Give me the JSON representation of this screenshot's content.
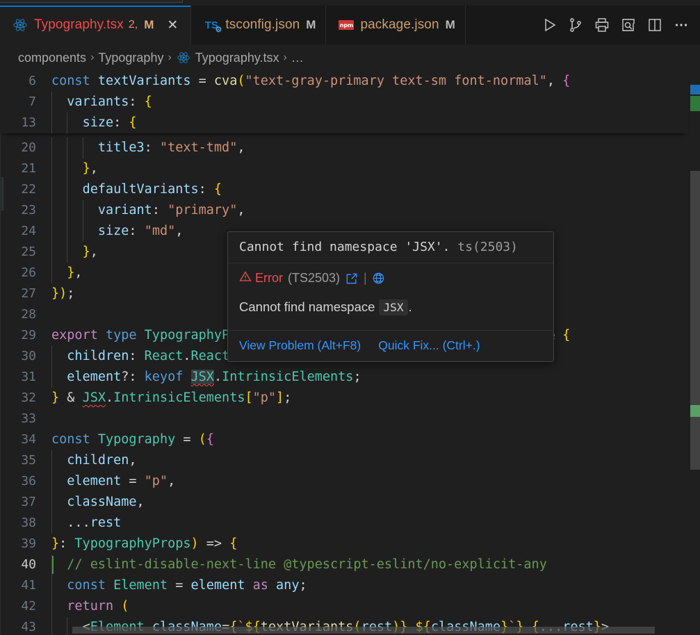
{
  "window": {
    "bg": "#1f1f1f",
    "accent": "#0078d4",
    "error_color": "#f14c4c",
    "link_color": "#3794ff"
  },
  "tabs": [
    {
      "name": "typography-tsx",
      "icon": "react-icon",
      "label": "Typography.tsx",
      "badge": "2,",
      "modified": "M",
      "active": true,
      "closable": true,
      "close_label": "✕"
    },
    {
      "name": "tsconfig-json",
      "icon": "typescript-config-icon",
      "icon_text": "TS",
      "icon_sub": "⚙",
      "label": "tsconfig.json",
      "badge": "",
      "modified": "M",
      "active": false,
      "closable": false
    },
    {
      "name": "package-json",
      "icon": "npm-icon",
      "icon_text": "npm",
      "label": "package.json",
      "badge": "",
      "modified": "M",
      "active": false,
      "closable": false
    }
  ],
  "toolbar": {
    "buttons": [
      {
        "name": "run-button",
        "icon": "play-icon",
        "title": "Run Code"
      },
      {
        "name": "source-control-button",
        "icon": "git-branch-icon",
        "title": "Source Control"
      },
      {
        "name": "print-button",
        "icon": "printer-icon",
        "title": "Print"
      },
      {
        "name": "preview-button",
        "icon": "open-preview-icon",
        "title": "Open Preview"
      },
      {
        "name": "split-editor-button",
        "icon": "split-editor-icon",
        "title": "Split Editor Right"
      },
      {
        "name": "more-actions-button",
        "icon": "ellipsis-icon",
        "title": "More Actions..."
      }
    ]
  },
  "breadcrumbs": {
    "separator": "›",
    "items": [
      {
        "name": "breadcrumb-components",
        "label": "components",
        "icon": ""
      },
      {
        "name": "breadcrumb-typography-folder",
        "label": "Typography",
        "icon": ""
      },
      {
        "name": "breadcrumb-typography-file",
        "label": "Typography.tsx",
        "icon": "react-icon"
      },
      {
        "name": "breadcrumb-overflow",
        "label": "…",
        "icon": ""
      }
    ]
  },
  "editor": {
    "sticky_lines": [
      {
        "num": "6",
        "text": "const textVariants = cva(\"text-gray-primary text-sm font-normal\", {"
      },
      {
        "num": "7",
        "text": "  variants: {"
      },
      {
        "num": "13",
        "text": "    size: {"
      }
    ],
    "lines": [
      {
        "num": "20",
        "text": "      title3: \"text-tmd\","
      },
      {
        "num": "21",
        "text": "    },"
      },
      {
        "num": "22",
        "text": "    defaultVariants: {"
      },
      {
        "num": "23",
        "text": "      variant: \"primary\","
      },
      {
        "num": "24",
        "text": "      size: \"md\","
      },
      {
        "num": "25",
        "text": "    },"
      },
      {
        "num": "26",
        "text": "  },"
      },
      {
        "num": "27",
        "text": "});"
      },
      {
        "num": "28",
        "text": ""
      },
      {
        "num": "29",
        "text": "export type TypographyProps = VariantProps<typeof textVariants> & {"
      },
      {
        "num": "30",
        "text": "  children: React.ReactNode;"
      },
      {
        "num": "31",
        "text": "  element?: keyof JSX.IntrinsicElements;"
      },
      {
        "num": "32",
        "text": "} & JSX.IntrinsicElements[\"p\"];"
      },
      {
        "num": "33",
        "text": ""
      },
      {
        "num": "34",
        "text": "const Typography = ({"
      },
      {
        "num": "35",
        "text": "  children,"
      },
      {
        "num": "36",
        "text": "  element = \"p\","
      },
      {
        "num": "37",
        "text": "  className,"
      },
      {
        "num": "38",
        "text": "  ...rest"
      },
      {
        "num": "39",
        "text": "}: TypographyProps) => {"
      },
      {
        "num": "40",
        "text": "  // eslint-disable-next-line @typescript-eslint/no-explicit-any",
        "modified": true
      },
      {
        "num": "41",
        "text": "  const Element = element as any;"
      },
      {
        "num": "42",
        "text": "  return ("
      },
      {
        "num": "43",
        "text": "    <Element className={`${textVariants(rest)} ${className}`} {...rest}>"
      }
    ]
  },
  "hover": {
    "signature": "Cannot find namespace 'JSX'.",
    "signature_code": "ts(2503)",
    "severity": "Error",
    "severity_icon": "warning-triangle-icon",
    "code": "(TS2503)",
    "open_link_icon": "external-link-icon",
    "divider": "|",
    "globe_icon": "globe-icon",
    "message_prefix": "Cannot find namespace",
    "message_code": "JSX",
    "message_suffix": ".",
    "actions": [
      {
        "name": "view-problem-action",
        "label": "View Problem (Alt+F8)"
      },
      {
        "name": "quick-fix-action",
        "label": "Quick Fix... (Ctrl+.)"
      }
    ]
  }
}
